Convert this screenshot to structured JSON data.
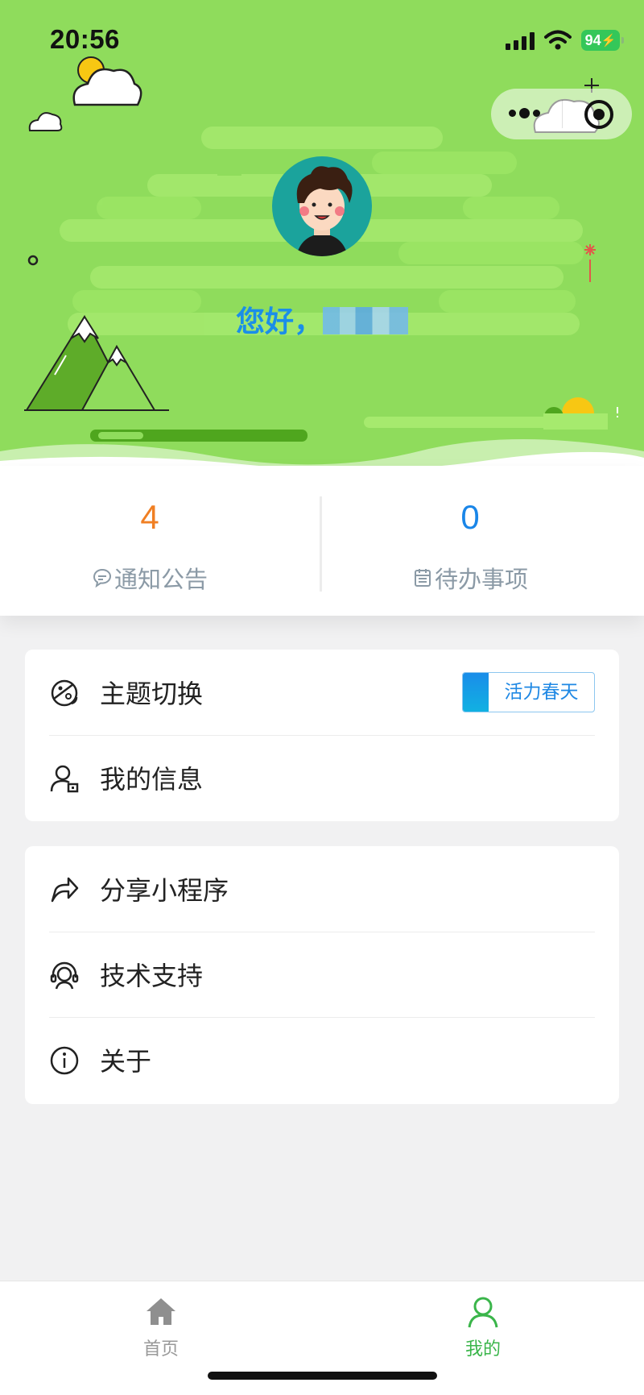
{
  "status_bar": {
    "time": "20:56",
    "battery": "94"
  },
  "header": {
    "greeting": "您好，",
    "theme_color": "#8fdc5c"
  },
  "stats": {
    "notices": {
      "value": "4",
      "label": "通知公告",
      "icon": "chat-bubble-icon",
      "color": "#f07f23"
    },
    "todos": {
      "value": "0",
      "label": "待办事项",
      "icon": "calendar-icon",
      "color": "#1a86e8"
    }
  },
  "menu_group1": {
    "theme": {
      "label": "主题切换",
      "icon": "palette-icon",
      "badge": "活力春天"
    },
    "profile": {
      "label": "我的信息",
      "icon": "user-id-icon"
    }
  },
  "menu_group2": {
    "share": {
      "label": "分享小程序",
      "icon": "share-arrow-icon"
    },
    "support": {
      "label": "技术支持",
      "icon": "headset-icon"
    },
    "about": {
      "label": "关于",
      "icon": "info-icon"
    }
  },
  "tabbar": {
    "home": {
      "label": "首页",
      "icon": "home-icon"
    },
    "me": {
      "label": "我的",
      "icon": "user-icon",
      "active": true,
      "active_color": "#3ab54a"
    }
  }
}
